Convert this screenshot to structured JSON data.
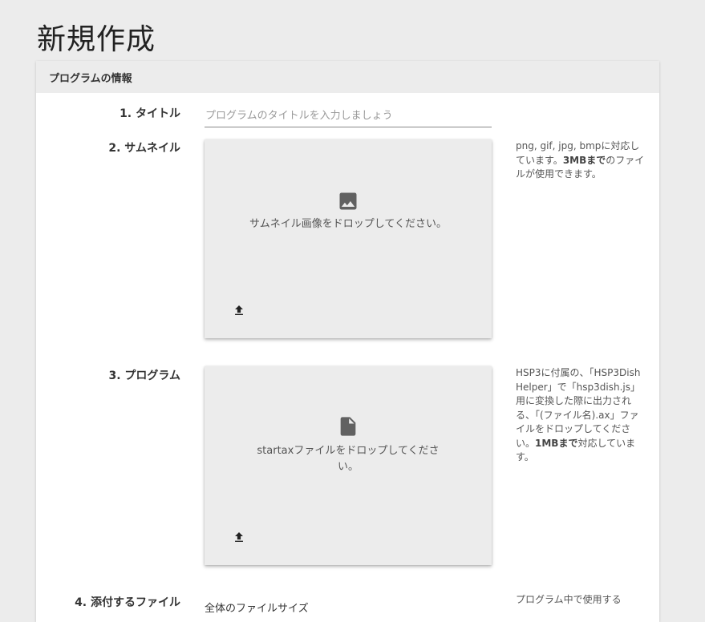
{
  "page": {
    "title": "新規作成"
  },
  "section": {
    "header": "プログラムの情報"
  },
  "fields": {
    "title": {
      "label": "1. タイトル",
      "placeholder": "プログラムのタイトルを入力しましょう",
      "value": ""
    },
    "thumbnail": {
      "label": "2. サムネイル",
      "drop_text": "サムネイル画像をドロップしてください。",
      "icon": "image-icon",
      "note": {
        "pre": "png, gif, jpg, bmpに対応しています。",
        "bold": "3MBまで",
        "post": "のファイルが使用できます。"
      }
    },
    "program": {
      "label": "3. プログラム",
      "drop_text": "startaxファイルをドロップしてください。",
      "icon": "file-icon",
      "note": {
        "pre": "HSP3に付属の、「HSP3Dish Helper」で「hsp3dish.js」用に変換した際に出力される、「(ファイル名).ax」ファイルをドロップしてください。",
        "bold": "1MBまで",
        "post": "対応しています。"
      }
    },
    "attachments": {
      "label": "4. 添付するファイル",
      "subtext": "全体のファイルサイズ",
      "note": "プログラム中で使用する"
    }
  },
  "icons": {
    "upload": "upload-icon"
  },
  "colors": {
    "background": "#ececec",
    "card": "#ffffff",
    "dropzone": "#ececec",
    "icon": "#616161"
  }
}
